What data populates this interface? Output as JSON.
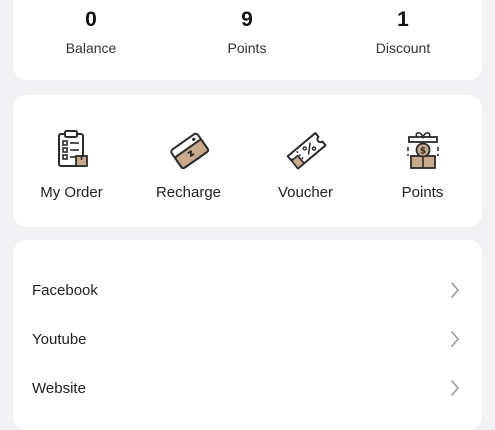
{
  "stats": [
    {
      "value": "0",
      "label": "Balance"
    },
    {
      "value": "9",
      "label": "Points"
    },
    {
      "value": "1",
      "label": "Discount"
    }
  ],
  "shortcuts": [
    {
      "label": "My Order",
      "icon": "clipboard-icon"
    },
    {
      "label": "Recharge",
      "icon": "recharge-card-icon"
    },
    {
      "label": "Voucher",
      "icon": "voucher-ticket-icon"
    },
    {
      "label": "Points",
      "icon": "gift-coin-icon"
    }
  ],
  "links": [
    {
      "label": "Facebook"
    },
    {
      "label": "Youtube"
    },
    {
      "label": "Website"
    }
  ],
  "colors": {
    "background": "#f2f2f5",
    "card": "#ffffff",
    "icon_accent": "#c9a98b",
    "icon_stroke": "#2b2b2b",
    "chevron": "#9a9a9a"
  }
}
